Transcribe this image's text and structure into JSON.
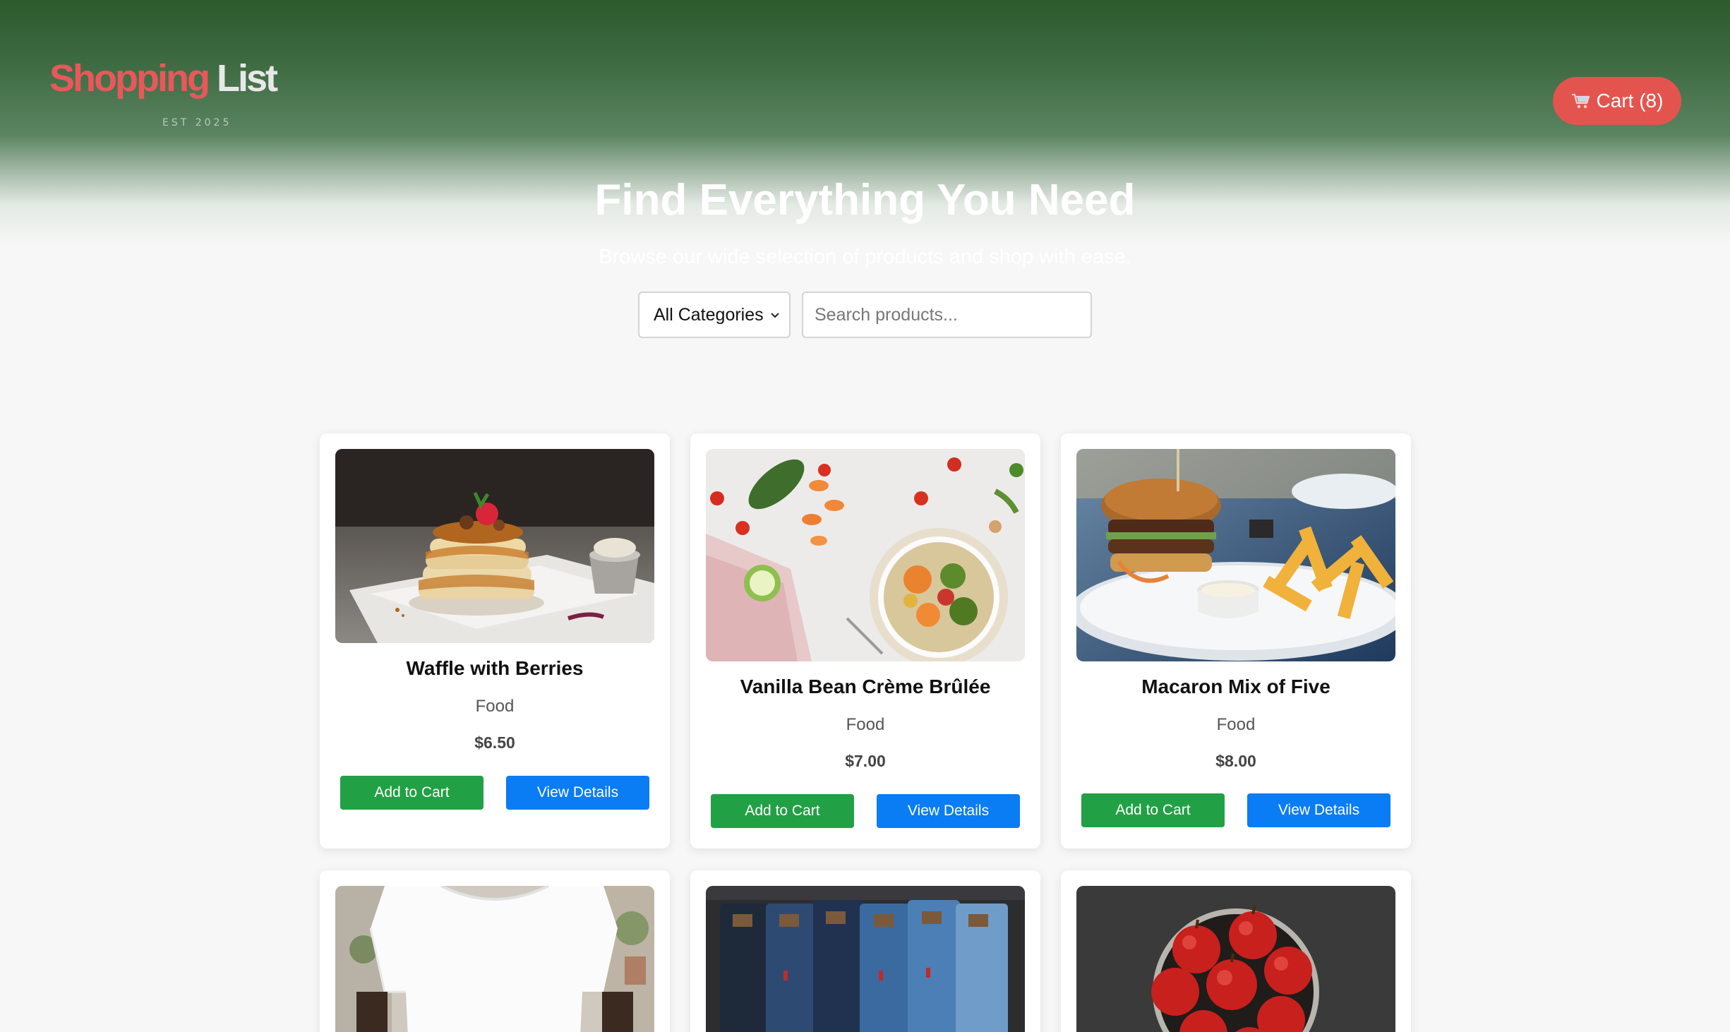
{
  "brand": {
    "name_part1": "Shopping",
    "name_part2": "List",
    "tagline": "EST 2025",
    "primary_color": "#e8585a"
  },
  "header": {
    "cart_label": "Cart (8)",
    "cart_icon": "shopping-cart-icon"
  },
  "hero": {
    "title": "Find Everything You Need",
    "subtitle": "Browse our wide selection of products and shop with ease."
  },
  "filters": {
    "category_selected": "All Categories",
    "search_placeholder": "Search products..."
  },
  "buttons": {
    "add_to_cart": "Add to Cart",
    "view_details": "View Details"
  },
  "colors": {
    "add_button": "#22a045",
    "view_button": "#0a7cf4",
    "cart_button": "#e4544f"
  },
  "products": [
    {
      "name": "Waffle with Berries",
      "category": "Food",
      "price": "$6.50",
      "image": "pancake-stack-photo"
    },
    {
      "name": "Vanilla Bean Crème Brûlée",
      "category": "Food",
      "price": "$7.00",
      "image": "vegetable-bowl-photo"
    },
    {
      "name": "Macaron Mix of Five",
      "category": "Food",
      "price": "$8.00",
      "image": "burger-and-fries-photo"
    },
    {
      "image": "white-tshirt-photo"
    },
    {
      "image": "denim-jeans-photo"
    },
    {
      "image": "red-apples-bowl-photo"
    }
  ]
}
